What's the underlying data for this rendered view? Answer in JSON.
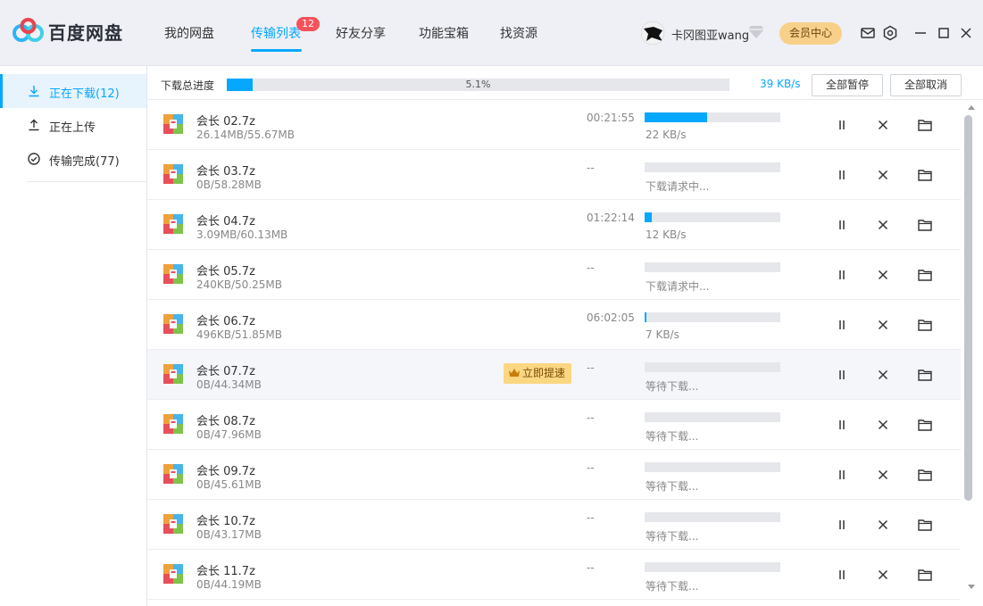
{
  "app": {
    "name": "百度网盘",
    "accent": "#06a7ff"
  },
  "nav": {
    "items": [
      {
        "label": "我的网盘"
      },
      {
        "label": "传输列表",
        "active": true,
        "badge": "12"
      },
      {
        "label": "好友分享"
      },
      {
        "label": "功能宝箱"
      },
      {
        "label": "找资源"
      }
    ]
  },
  "user": {
    "name": "卡冈图亚wang",
    "vip_label": "会员中心"
  },
  "header_icons": [
    "mail-icon",
    "settings-icon",
    "minimize-icon",
    "maximize-icon",
    "close-icon"
  ],
  "sidebar": {
    "items": [
      {
        "label": "正在下载(12)",
        "icon": "download-icon",
        "active": true
      },
      {
        "label": "正在上传",
        "icon": "upload-icon"
      },
      {
        "label": "传输完成(77)",
        "icon": "check-circle-icon"
      }
    ]
  },
  "overall": {
    "label": "下载总进度",
    "percent_text": "5.1%",
    "progress": 0.051,
    "speed": "39 KB/s",
    "pause_all": "全部暂停",
    "cancel_all": "全部取消"
  },
  "boost_label": "立即提速",
  "files": [
    {
      "name": "会长 02.7z",
      "size": "26.14MB/55.67MB",
      "time": "00:21:55",
      "progress": 0.46,
      "status": "22 KB/s"
    },
    {
      "name": "会长 03.7z",
      "size": "0B/58.28MB",
      "time": "--",
      "progress": 0,
      "status": "下载请求中..."
    },
    {
      "name": "会长 04.7z",
      "size": "3.09MB/60.13MB",
      "time": "01:22:14",
      "progress": 0.05,
      "status": "12 KB/s"
    },
    {
      "name": "会长 05.7z",
      "size": "240KB/50.25MB",
      "time": "--",
      "progress": 0,
      "status": "下载请求中..."
    },
    {
      "name": "会长 06.7z",
      "size": "496KB/51.85MB",
      "time": "06:02:05",
      "progress": 0.01,
      "status": "7 KB/s"
    },
    {
      "name": "会长 07.7z",
      "size": "0B/44.34MB",
      "time": "--",
      "progress": 0,
      "status": "等待下载..."
    },
    {
      "name": "会长 08.7z",
      "size": "0B/47.96MB",
      "time": "--",
      "progress": 0,
      "status": "等待下载..."
    },
    {
      "name": "会长 09.7z",
      "size": "0B/45.61MB",
      "time": "--",
      "progress": 0,
      "status": "等待下载..."
    },
    {
      "name": "会长 10.7z",
      "size": "0B/43.17MB",
      "time": "--",
      "progress": 0,
      "status": "等待下载..."
    },
    {
      "name": "会长 11.7z",
      "size": "0B/44.19MB",
      "time": "--",
      "progress": 0,
      "status": "等待下载..."
    }
  ]
}
